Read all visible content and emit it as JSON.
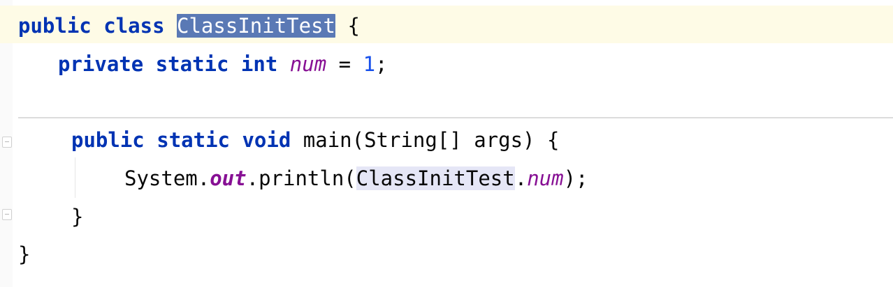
{
  "code": {
    "line1": {
      "kw_public": "public",
      "kw_class": "class",
      "class_name": "ClassInitTest",
      "brace": "{"
    },
    "line2": {
      "kw_private": "private",
      "kw_static": "static",
      "kw_int": "int",
      "field": "num",
      "op": "=",
      "value": "1",
      "semi": ";"
    },
    "line3": {
      "kw_public": "public",
      "kw_static": "static",
      "kw_void": "void",
      "signature": "main(String[] args)",
      "brace": "{"
    },
    "line4": {
      "system": "System.",
      "out": "out",
      "call": ".println(",
      "class_ref": "ClassInitTest",
      "dot": ".",
      "field": "num",
      "end": ");"
    },
    "line5": {
      "brace": "}"
    },
    "line6": {
      "brace": "}"
    }
  }
}
